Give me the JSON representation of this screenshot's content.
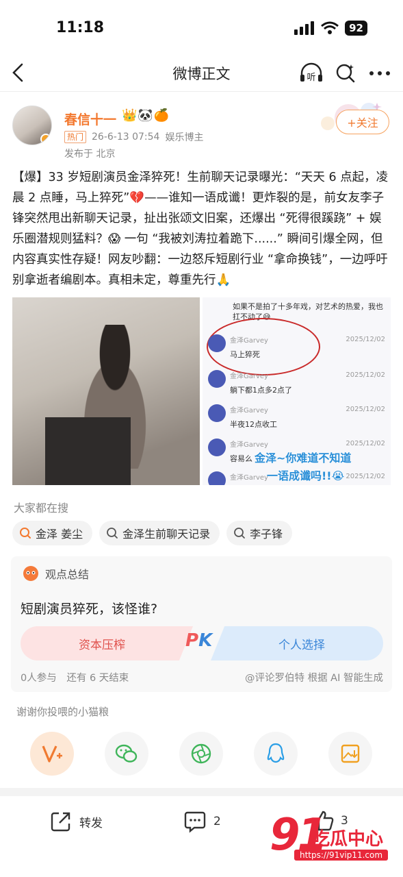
{
  "status_bar": {
    "time": "11:18",
    "battery": "92"
  },
  "nav": {
    "title": "微博正文",
    "listen_label": "听"
  },
  "post": {
    "username": "春信十一",
    "badges": "👑🐼🍊",
    "hot_tag": "热门",
    "date": "26-6-13 07:54",
    "category": "娱乐博主",
    "published_from": "发布于 北京",
    "follow_label": "+关注",
    "text": "【爆】33 岁短剧演员金泽猝死！生前聊天记录曝光：“天天 6 点起，凌晨 2 点睡，马上猝死”💔——谁知一语成谶！更炸裂的是，前女友李子锋突然甩出新聊天记录，扯出张颂文旧案，还爆出 “死得很蹊跷” + 娱乐圈潜规则猛料？😱 一句 “我被刘涛拉着跪下......” 瞬间引爆全网，但内容真实性存疑！网友吵翻：一边怒斥短剧行业 “拿命换钱”，一边呼吁别拿逝者编剧本。真相未定，尊重先行🙏"
  },
  "chat_image": {
    "top_message": "如果不是拍了十多年戏，对艺术的热爱，我也扛不动了😅",
    "messages": [
      {
        "name": "金泽Garvey",
        "date": "2025/12/02",
        "text": "马上猝死"
      },
      {
        "name": "金泽Garvey",
        "date": "2025/12/02",
        "text": "躺下都1点多2点了"
      },
      {
        "name": "金泽Garvey",
        "date": "2025/12/02",
        "text": "半夜12点收工"
      },
      {
        "name": "金泽Garvey",
        "date": "2025/12/02",
        "text": "容易么"
      },
      {
        "name": "金泽Garvey",
        "date": "2025/12/02",
        "text": ""
      }
    ],
    "overlay_line1": "金泽~你难道不知道",
    "overlay_line2": "一语成谶吗!!😭"
  },
  "search": {
    "title": "大家都在搜",
    "chips": [
      "金泽 姜尘",
      "金泽生前聊天记录",
      "李子锋"
    ]
  },
  "opinion": {
    "header": "观点总结",
    "question": "短剧演员猝死，该怪谁?",
    "left_option": "资本压榨",
    "right_option": "个人选择",
    "pk_p": "P",
    "pk_k": "K",
    "participants": "0人参与",
    "remaining": "还有 6 天结束",
    "source": "@评论罗伯特 根据 AI 智能生成"
  },
  "share": {
    "thanks": "谢谢你投喂的小猫粮"
  },
  "bottom_bar": {
    "repost_label": "转发",
    "comment_count": "2",
    "like_count": "3"
  },
  "watermark": {
    "number": "91",
    "text": "吃瓜中心",
    "url": "https://91vip11.com"
  }
}
